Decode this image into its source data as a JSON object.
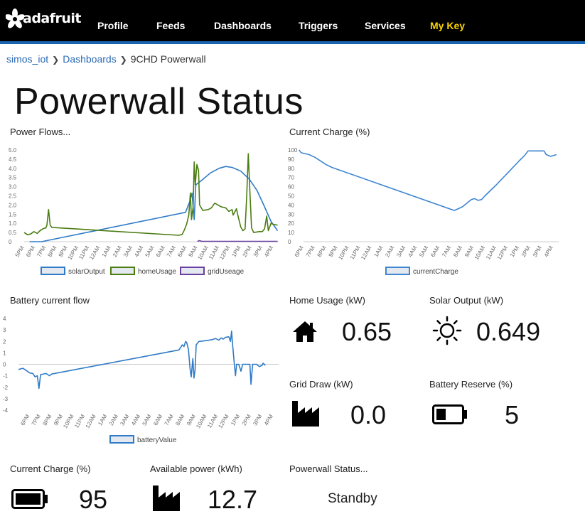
{
  "nav": {
    "logo_text": "adafruit",
    "items": [
      "Profile",
      "Feeds",
      "Dashboards",
      "Triggers",
      "Services",
      "My Key"
    ]
  },
  "breadcrumb": {
    "user": "simos_iot",
    "section": "Dashboards",
    "current": "9CHD Powerwall"
  },
  "page_title": "Powerwall Status",
  "blocks": {
    "power_flows": {
      "title": "Power Flows..."
    },
    "current_charge_chart": {
      "title": "Current Charge (%)"
    },
    "battery_flow": {
      "title": "Battery current flow"
    },
    "home_usage": {
      "title": "Home Usage (kW)",
      "value": "0.65",
      "icon": "house-icon"
    },
    "solar_output": {
      "title": "Solar Output (kW)",
      "value": "0.649",
      "icon": "sun-icon"
    },
    "grid_draw": {
      "title": "Grid Draw (kW)",
      "value": "0.0",
      "icon": "factory-icon"
    },
    "battery_reserve": {
      "title": "Battery Reserve (%)",
      "value": "5",
      "icon": "battery-low-icon"
    },
    "current_charge": {
      "title": "Current Charge (%)",
      "value": "95",
      "icon": "battery-full-icon"
    },
    "available_power": {
      "title": "Available power (kWh)",
      "value": "12.7",
      "icon": "factory-icon"
    },
    "powerwall_status": {
      "title": "Powerwall Status...",
      "value": "Standby"
    }
  },
  "colors": {
    "solar": "#2f7bc8",
    "home": "#4a7d12",
    "grid": "#6a3fa0",
    "charge": "#3f86d0",
    "battery": "#2f7bc8"
  },
  "chart_data": [
    {
      "type": "line",
      "x_ticks": [
        "5PM",
        "6PM",
        "7PM",
        "8PM",
        "9PM",
        "10PM",
        "11PM",
        "12AM",
        "1AM",
        "2AM",
        "3AM",
        "4AM",
        "5AM",
        "6AM",
        "7AM",
        "8AM",
        "9AM",
        "10AM",
        "11AM",
        "12PM",
        "1PM",
        "2PM",
        "3PM",
        "4PM"
      ],
      "xlim": [
        17,
        40.5
      ],
      "ylim": [
        0,
        5
      ],
      "y_ticks": [
        "0",
        "0.5",
        "1.0",
        "1.5",
        "2.0",
        "2.5",
        "3.0",
        "3.5",
        "4.0",
        "4.5",
        "5.0"
      ],
      "series": [
        {
          "name": "solarOutput",
          "color": "#2f7bc8",
          "points": [
            [
              17.5,
              0
            ],
            [
              18.6,
              0
            ],
            [
              31.9,
              1.6
            ],
            [
              32.3,
              2.2
            ],
            [
              32.5,
              2.65
            ],
            [
              32.7,
              1.2
            ],
            [
              32.85,
              3.1
            ],
            [
              33.4,
              3.35
            ],
            [
              34.2,
              3.75
            ],
            [
              35.0,
              4.0
            ],
            [
              35.6,
              4.1
            ],
            [
              36.2,
              4.05
            ],
            [
              37.0,
              3.85
            ],
            [
              37.8,
              3.4
            ],
            [
              38.5,
              2.8
            ],
            [
              39.2,
              1.9
            ],
            [
              39.8,
              1.1
            ],
            [
              40.4,
              0.6
            ]
          ]
        },
        {
          "name": "homeUsage",
          "color": "#4a7d12",
          "points": [
            [
              17.0,
              0.5
            ],
            [
              17.3,
              0.38
            ],
            [
              17.6,
              0.42
            ],
            [
              17.9,
              0.55
            ],
            [
              18.2,
              0.45
            ],
            [
              18.5,
              0.62
            ],
            [
              18.8,
              0.72
            ],
            [
              19.0,
              0.75
            ],
            [
              19.1,
              0.9
            ],
            [
              19.25,
              1.75
            ],
            [
              19.4,
              0.9
            ],
            [
              19.55,
              0.78
            ],
            [
              31.3,
              0.35
            ],
            [
              31.6,
              0.4
            ],
            [
              31.8,
              0.65
            ],
            [
              32.0,
              0.95
            ],
            [
              32.2,
              1.45
            ],
            [
              32.35,
              2.65
            ],
            [
              32.45,
              1.2
            ],
            [
              32.6,
              1.9
            ],
            [
              32.7,
              4.35
            ],
            [
              32.8,
              3.1
            ],
            [
              32.95,
              4.2
            ],
            [
              33.1,
              3.9
            ],
            [
              33.2,
              2.0
            ],
            [
              33.5,
              1.7
            ],
            [
              34.0,
              1.75
            ],
            [
              34.3,
              1.85
            ],
            [
              34.6,
              2.1
            ],
            [
              34.9,
              2.0
            ],
            [
              35.2,
              1.9
            ],
            [
              35.6,
              1.85
            ],
            [
              35.9,
              1.65
            ],
            [
              36.2,
              1.75
            ],
            [
              36.3,
              1.45
            ],
            [
              36.6,
              1.8
            ],
            [
              36.75,
              1.4
            ],
            [
              37.0,
              0.8
            ],
            [
              37.2,
              0.6
            ],
            [
              37.4,
              0.7
            ],
            [
              37.55,
              2.5
            ],
            [
              37.7,
              4.8
            ],
            [
              37.85,
              2.7
            ],
            [
              38.0,
              0.75
            ],
            [
              38.2,
              0.5
            ],
            [
              38.7,
              0.55
            ],
            [
              39.0,
              0.55
            ],
            [
              39.2,
              0.7
            ],
            [
              39.4,
              1.4
            ],
            [
              39.55,
              0.6
            ],
            [
              39.8,
              1.0
            ],
            [
              40.0,
              0.95
            ],
            [
              40.4,
              0.9
            ]
          ]
        },
        {
          "name": "gridUseage",
          "color": "#6a3fa0",
          "points": [
            [
              33.0,
              0.02
            ],
            [
              33.2,
              0.06
            ],
            [
              33.4,
              0.02
            ],
            [
              40.4,
              0.02
            ]
          ]
        }
      ]
    },
    {
      "type": "line",
      "x_ticks": [
        "6PM",
        "7PM",
        "8PM",
        "9PM",
        "10PM",
        "11PM",
        "12AM",
        "1AM",
        "2AM",
        "3AM",
        "4AM",
        "5AM",
        "6AM",
        "7AM",
        "8AM",
        "9AM",
        "10AM",
        "11AM",
        "12PM",
        "1PM",
        "2PM",
        "3PM",
        "4PM"
      ],
      "xlim": [
        18,
        40.5
      ],
      "ylim": [
        0,
        100
      ],
      "y_ticks": [
        "0",
        "10",
        "20",
        "30",
        "40",
        "50",
        "60",
        "70",
        "80",
        "90",
        "100"
      ],
      "series": [
        {
          "name": "currentCharge",
          "color": "#3f86d0",
          "points": [
            [
              17.6,
              100
            ],
            [
              17.8,
              97
            ],
            [
              18.5,
              95
            ],
            [
              19.0,
              92
            ],
            [
              20.0,
              84
            ],
            [
              20.5,
              81
            ],
            [
              31.3,
              34
            ],
            [
              32.0,
              38
            ],
            [
              32.8,
              46
            ],
            [
              33.1,
              47
            ],
            [
              33.4,
              45
            ],
            [
              33.7,
              46
            ],
            [
              34.0,
              50
            ],
            [
              35.0,
              62
            ],
            [
              36.0,
              75
            ],
            [
              37.0,
              88
            ],
            [
              37.5,
              94
            ],
            [
              37.8,
              99
            ],
            [
              39.2,
              99
            ],
            [
              39.4,
              95
            ],
            [
              39.8,
              93
            ],
            [
              40.3,
              95
            ]
          ]
        }
      ]
    },
    {
      "type": "line",
      "x_ticks": [
        "6PM",
        "7PM",
        "8PM",
        "9PM",
        "10PM",
        "11PM",
        "12AM",
        "1AM",
        "2AM",
        "3AM",
        "4AM",
        "5AM",
        "6AM",
        "7AM",
        "8AM",
        "9AM",
        "10AM",
        "11AM",
        "12PM",
        "1PM",
        "2PM",
        "3PM",
        "4PM"
      ],
      "xlim": [
        17,
        40.5
      ],
      "ylim": [
        -4,
        4
      ],
      "y_ticks": [
        "-4",
        "-3",
        "-2",
        "-1",
        "0",
        "1",
        "2",
        "3",
        "4"
      ],
      "series": [
        {
          "name": "batteryValue",
          "color": "#2f7bc8",
          "points": [
            [
              17.0,
              -0.45
            ],
            [
              17.4,
              -0.35
            ],
            [
              17.8,
              -0.6
            ],
            [
              18.0,
              -0.75
            ],
            [
              18.3,
              -0.8
            ],
            [
              18.5,
              -1.1
            ],
            [
              18.7,
              -1.0
            ],
            [
              18.85,
              -2.1
            ],
            [
              19.0,
              -0.9
            ],
            [
              19.5,
              -0.8
            ],
            [
              19.8,
              -1.0
            ],
            [
              20.0,
              -0.85
            ],
            [
              31.5,
              1.25
            ],
            [
              31.8,
              1.7
            ],
            [
              31.95,
              1.55
            ],
            [
              32.1,
              2.0
            ],
            [
              32.2,
              1.9
            ],
            [
              32.35,
              1.3
            ],
            [
              32.5,
              -0.4
            ],
            [
              32.6,
              -1.1
            ],
            [
              32.75,
              0.5
            ],
            [
              32.85,
              -1.2
            ],
            [
              32.95,
              -0.5
            ],
            [
              33.05,
              1.7
            ],
            [
              33.3,
              2.0
            ],
            [
              33.8,
              2.05
            ],
            [
              34.2,
              2.1
            ],
            [
              34.5,
              2.15
            ],
            [
              34.8,
              2.25
            ],
            [
              35.1,
              2.1
            ],
            [
              35.3,
              2.3
            ],
            [
              35.5,
              2.2
            ],
            [
              35.7,
              2.35
            ],
            [
              36.0,
              2.4
            ],
            [
              36.15,
              2.0
            ],
            [
              36.25,
              2.9
            ],
            [
              36.35,
              1.6
            ],
            [
              36.5,
              0.0
            ],
            [
              36.6,
              -1.0
            ],
            [
              36.7,
              0.0
            ],
            [
              36.9,
              0.0
            ],
            [
              37.1,
              -0.6
            ],
            [
              37.25,
              0.0
            ],
            [
              37.9,
              0.0
            ],
            [
              38.0,
              -1.75
            ],
            [
              38.15,
              0.0
            ],
            [
              38.5,
              0.0
            ],
            [
              38.75,
              -0.2
            ],
            [
              39.0,
              -0.1
            ],
            [
              39.1,
              0.1
            ],
            [
              39.3,
              -0.1
            ]
          ]
        }
      ]
    }
  ]
}
